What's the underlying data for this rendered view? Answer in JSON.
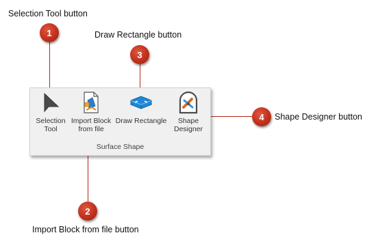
{
  "callouts": [
    {
      "number": "1",
      "text": "Selection Tool button"
    },
    {
      "number": "2",
      "text": "Import Block from file button"
    },
    {
      "number": "3",
      "text": "Draw Rectangle button"
    },
    {
      "number": "4",
      "text": "Shape Designer button"
    }
  ],
  "ribbon": {
    "group_label": "Surface Shape",
    "tools": [
      {
        "label_line1": "Selection",
        "label_line2": "Tool",
        "icon": "cursor-arrow-icon"
      },
      {
        "label_line1": "Import Block",
        "label_line2": "from file",
        "icon": "import-block-icon"
      },
      {
        "label_line1": "Draw Rectangle",
        "label_line2": "",
        "icon": "draw-rectangle-icon"
      },
      {
        "label_line1": "Shape",
        "label_line2": "Designer",
        "icon": "shape-designer-icon"
      }
    ]
  },
  "colors": {
    "badge": "#c0301c",
    "leader_line": "#b22a18",
    "ribbon_bg": "#f0f0f0",
    "accent_blue": "#1e88d6"
  }
}
